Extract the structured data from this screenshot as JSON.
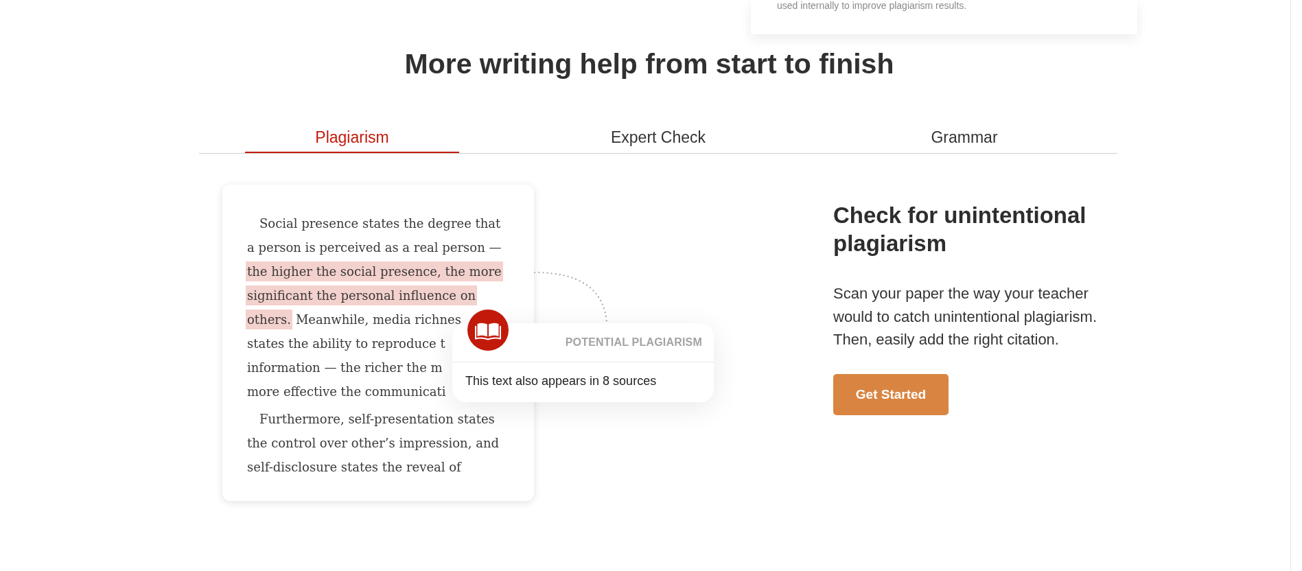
{
  "top_card": {
    "text": "used internally to improve plagiarism results."
  },
  "headline": "More writing help from start to finish",
  "tabs": [
    {
      "label": "Plagiarism",
      "selected": true
    },
    {
      "label": "Expert Check",
      "selected": false
    },
    {
      "label": "Grammar",
      "selected": false
    }
  ],
  "document": {
    "paragraphs": [
      {
        "lines": [
          {
            "segments": [
              {
                "text": "Social presence states the degree that",
                "highlighted": false
              }
            ]
          },
          {
            "segments": [
              {
                "text": "a person is perceived as a real person —",
                "highlighted": false
              }
            ]
          },
          {
            "segments": [
              {
                "text": "the higher the social presence, the more",
                "highlighted": true
              }
            ]
          },
          {
            "segments": [
              {
                "text": "significant the personal influence on",
                "highlighted": true
              }
            ]
          },
          {
            "segments": [
              {
                "text": "others.",
                "highlighted": true
              },
              {
                "text": "Meanwhile, media richnes",
                "highlighted": false
              }
            ]
          },
          {
            "segments": [
              {
                "text": "states the ability to reproduce t",
                "highlighted": false
              }
            ]
          },
          {
            "segments": [
              {
                "text": "information — the richer the m",
                "highlighted": false
              }
            ]
          },
          {
            "segments": [
              {
                "text": "more effective the communicati",
                "highlighted": false
              }
            ]
          }
        ]
      },
      {
        "lines": [
          {
            "segments": [
              {
                "text": "Furthermore, self-presentation states",
                "highlighted": false
              }
            ]
          },
          {
            "segments": [
              {
                "text": "the control over other’s impression, and",
                "highlighted": false
              }
            ]
          },
          {
            "segments": [
              {
                "text": "self-disclosure states the reveal of",
                "highlighted": false
              }
            ]
          }
        ]
      }
    ]
  },
  "popup": {
    "title": "POTENTIAL PLAGIARISM",
    "message": "This text also appears in 8 sources"
  },
  "feature": {
    "title": "Check for unintentional plagiarism",
    "description": "Scan your paper the way your teacher would to catch unintentional plagiarism. Then, easily add the right citation.",
    "button": "Get Started"
  }
}
